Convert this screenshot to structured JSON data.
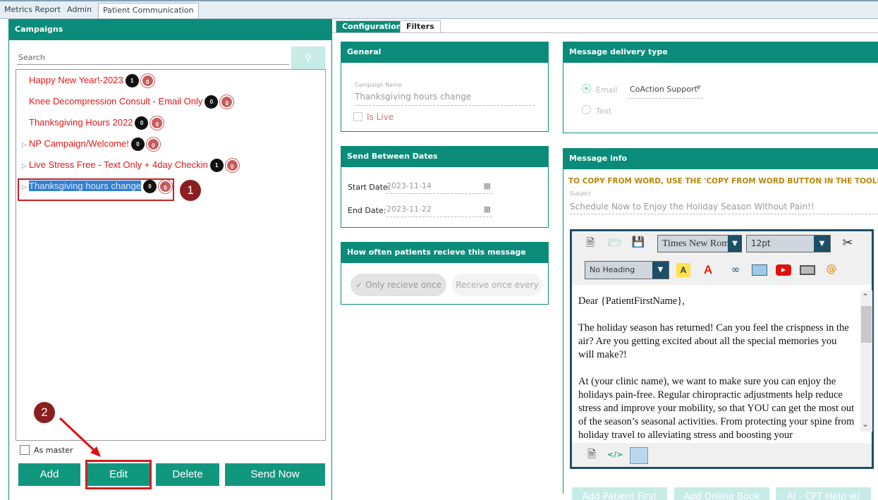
{
  "tabs": {
    "metrics": "Metrics Report",
    "admin": "Admin",
    "patient": "Patient Communication"
  },
  "campaigns": {
    "title": "Campaigns",
    "search_placeholder": "Search",
    "items": [
      {
        "name": "Happy New Year!-2023",
        "count": "1",
        "count2": "0",
        "expand": false
      },
      {
        "name": "Knee Decompression Consult - Email Only",
        "count": "0",
        "count2": "0",
        "expand": false
      },
      {
        "name": "Thanksgiving Hours 2022",
        "count": "0",
        "count2": "0",
        "expand": false
      },
      {
        "name": "NP Campaign/Welcome!",
        "count": "0",
        "count2": "0",
        "expand": true
      },
      {
        "name": "Live Stress Free - Text Only + 4day Checkin",
        "count": "1",
        "count2": "0",
        "expand": true
      },
      {
        "name": "Thanksgiving hours change",
        "count": "0",
        "count2": "0",
        "expand": true,
        "selected": true
      }
    ],
    "as_master": "As master",
    "buttons": {
      "add": "Add",
      "edit": "Edit",
      "delete": "Delete",
      "send": "Send Now"
    }
  },
  "callouts": {
    "one": "1",
    "two": "2"
  },
  "config_tabs": {
    "configuration": "Configuration",
    "filters": "Filters"
  },
  "general": {
    "title": "General",
    "name_label": "Campaign Name",
    "name_value": "Thanksgiving hours change",
    "is_live": "Is Live"
  },
  "delivery": {
    "title": "Message delivery type",
    "email": "Email",
    "text": "Text",
    "sender": "CoAction Support"
  },
  "dates": {
    "title": "Send Between Dates",
    "start_label": "Start Date:",
    "start_value": "2023-11-14",
    "end_label": "End Date:",
    "end_value": "2023-11-22"
  },
  "frequency": {
    "title": "How often patients recieve this message",
    "once": "Only recieve once",
    "every": "Receive once every"
  },
  "message": {
    "title": "Message info",
    "notice": "TO COPY FROM WORD, USE THE 'COPY FROM WORD BUTTON IN THE TOOLBAR",
    "subject_label": "Subject",
    "subject_value": "Schedule Now to Enjoy the Holiday Season Without Pain!!",
    "font": "Times New Roman",
    "size": "12pt",
    "heading": "No Heading",
    "body": [
      "Dear {PatientFirstName},",
      "The holiday season has returned! Can you feel the crispness in the air? Are you getting excited about all the special memories you will make?!",
      "At (your clinic name), we want to make sure you can enjoy the holidays pain-free. Regular chiropractic adjustments help reduce stress and improve your mobility, so that YOU can get the most out of the season’s seasonal activities. From protecting your spine from holiday travel to alleviating stress and boosting your"
    ],
    "bottom_buttons": [
      "Add Patient First",
      "Add Online Book",
      "AI - CPT Help w/"
    ]
  },
  "colors": {
    "teal": "#0b8c7a",
    "button": "#12977f",
    "campaign_text": "#e01818",
    "callout": "#8b1e1e",
    "highlight": "#cc1f1f"
  }
}
